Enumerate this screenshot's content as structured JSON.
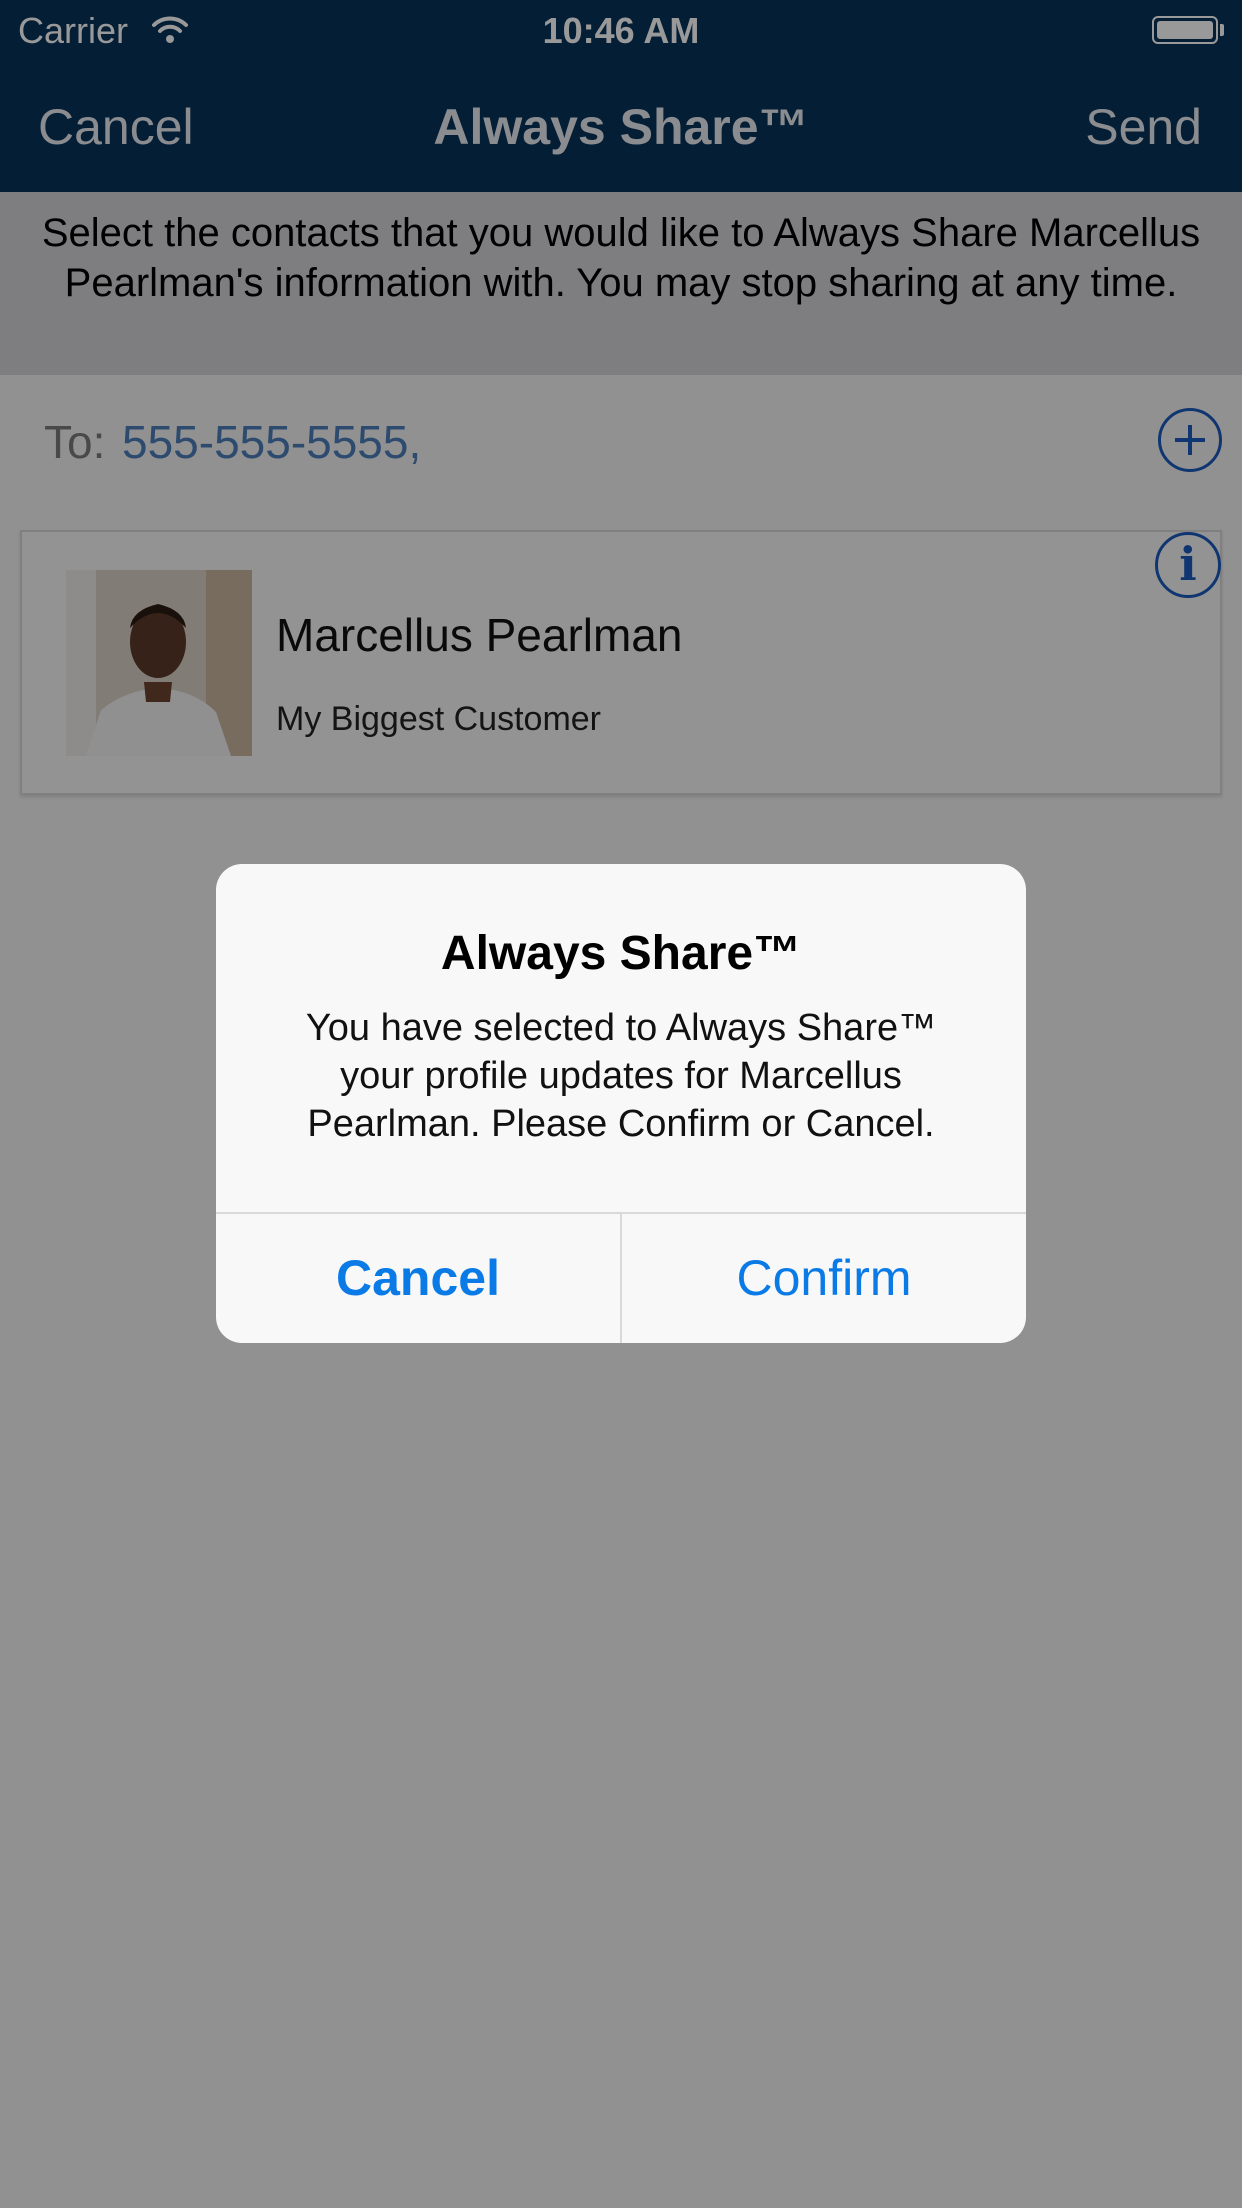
{
  "status_bar": {
    "carrier": "Carrier",
    "time": "10:46 AM"
  },
  "nav": {
    "cancel_label": "Cancel",
    "title": "Always Share™",
    "send_label": "Send"
  },
  "instructions": "Select the contacts that you would like to Always Share Marcellus  Pearlman's information with. You may stop sharing at any time.",
  "to_field": {
    "label": "To:",
    "value": "555-555-5555,"
  },
  "contact": {
    "name": "Marcellus  Pearlman",
    "subtitle": "My Biggest Customer"
  },
  "alert": {
    "title": "Always Share™",
    "message": "You have selected to Always Share™ your profile updates for Marcellus Pearlman. Please Confirm or Cancel.",
    "cancel_label": "Cancel",
    "confirm_label": "Confirm"
  },
  "colors": {
    "nav_bg": "#07325a",
    "link_blue": "#0a7ae6",
    "accent_blue": "#1c5bbd"
  }
}
